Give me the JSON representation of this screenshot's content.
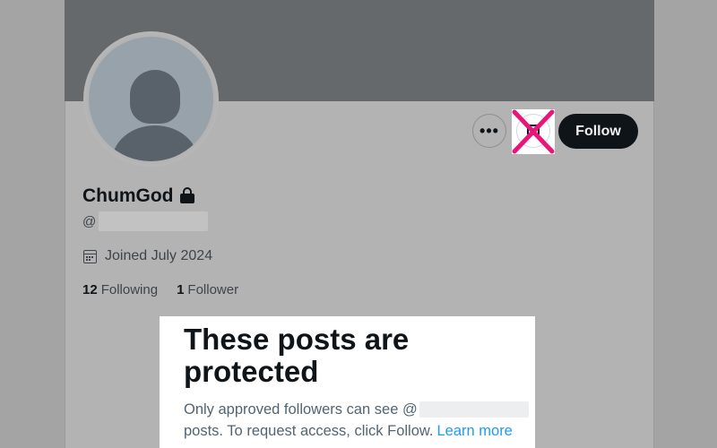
{
  "profile": {
    "display_name": "ChumGod",
    "handle_prefix": "@",
    "joined": "Joined July 2024",
    "following_count": "12",
    "following_label": "Following",
    "followers_count": "1",
    "followers_label": "Follower"
  },
  "actions": {
    "more_label": "•••",
    "follow_label": "Follow"
  },
  "protected_notice": {
    "title": "These posts are protected",
    "body_line1": "Only approved followers can see @",
    "body_line2": "posts. To request access, click Follow.",
    "learn_more": "Learn more"
  },
  "colors": {
    "accent": "#1d9bf0",
    "follow_button_bg": "#0f1419",
    "annotation_x": "#e8157a"
  },
  "icons": {
    "more": "ellipsis-icon",
    "message": "envelope-icon",
    "lock": "lock-icon",
    "calendar": "calendar-icon"
  }
}
